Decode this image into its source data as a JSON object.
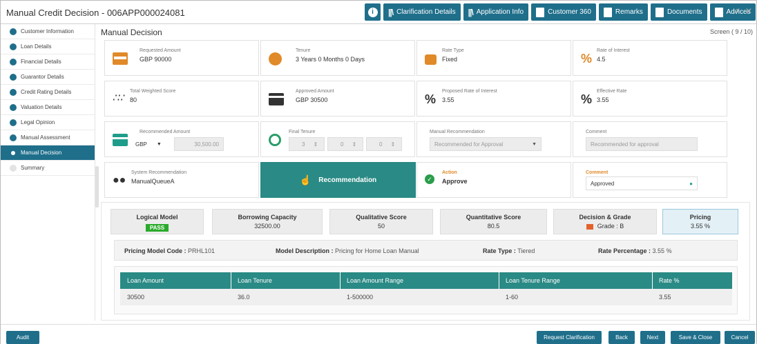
{
  "app": {
    "title": "Manual Credit Decision - 006APP000024081"
  },
  "toolbar": {
    "info_label": "i",
    "clarification": "Clarification Details",
    "application_info": "Application Info",
    "customer360": "Customer 360",
    "remarks": "Remarks",
    "documents": "Documents",
    "advices": "Advices"
  },
  "sidebar": {
    "items": [
      {
        "label": "Customer Information"
      },
      {
        "label": "Loan Details"
      },
      {
        "label": "Financial Details"
      },
      {
        "label": "Guarantor Details"
      },
      {
        "label": "Credit Rating Details"
      },
      {
        "label": "Valuation Details"
      },
      {
        "label": "Legal Opinion"
      },
      {
        "label": "Manual Assessment"
      },
      {
        "label": "Manual Decision"
      },
      {
        "label": "Summary"
      }
    ]
  },
  "main": {
    "title": "Manual Decision",
    "screen": "Screen ( 9 / 10)"
  },
  "cards": {
    "requested": {
      "label": "Requested Amount",
      "value": "GBP 90000"
    },
    "tenure": {
      "label": "Tenure",
      "value": "3 Years 0 Months 0 Days"
    },
    "rate_type": {
      "label": "Rate Type",
      "value": "Fixed"
    },
    "roi": {
      "label": "Rate of Interest",
      "value": "4.5"
    },
    "tws": {
      "label": "Total Weighted Score",
      "value": "80"
    },
    "approved": {
      "label": "Approved Amount",
      "value": "GBP 30500"
    },
    "proposed": {
      "label": "Proposed Rate of Interest",
      "value": "3.55"
    },
    "effective": {
      "label": "Effective Rate",
      "value": "3.55"
    },
    "recommended": {
      "label": "Recommended Amount",
      "currency": "GBP",
      "amount": "30,500.00"
    },
    "final_tenure": {
      "label": "Final Tenure",
      "years": "3",
      "months": "0",
      "days": "0"
    },
    "manual_rec": {
      "label": "Manual Recommendation",
      "value": "Recommended for Approval"
    },
    "comment1": {
      "label": "Comment",
      "value": "Recommended for approval"
    },
    "system_rec": {
      "label": "System Recommendation",
      "value": "ManualQueueA"
    },
    "recommendation_btn": "Recommendation",
    "action": {
      "label": "Action",
      "value": "Approve"
    },
    "comment2": {
      "label": "Comment",
      "value": "Approved"
    }
  },
  "models": {
    "logical": {
      "title": "Logical Model",
      "value": "PASS"
    },
    "borrowing": {
      "title": "Borrowing Capacity",
      "value": "32500.00"
    },
    "qualitative": {
      "title": "Qualitative Score",
      "value": "50"
    },
    "quantitative": {
      "title": "Quantitative Score",
      "value": "80.5"
    },
    "decision": {
      "title": "Decision & Grade",
      "value": "Grade : B"
    },
    "pricing": {
      "title": "Pricing",
      "value": "3.55 %"
    }
  },
  "pricing_info": {
    "code_label": "Pricing Model Code :",
    "code": "PRHL101",
    "desc_label": "Model Description :",
    "desc": "Pricing for Home Loan Manual",
    "type_label": "Rate Type :",
    "type": "Tiered",
    "pct_label": "Rate Percentage :",
    "pct": "3.55 %"
  },
  "table": {
    "headers": [
      "Loan Amount",
      "Loan Tenure",
      "Loan Amount Range",
      "Loan Tenure Range",
      "Rate %"
    ],
    "rows": [
      [
        "30500",
        "36.0",
        "1-500000",
        "1-60",
        "3.55"
      ]
    ]
  },
  "footer": {
    "audit": "Audit",
    "request": "Request Clarification",
    "back": "Back",
    "next": "Next",
    "save": "Save & Close",
    "cancel": "Cancel"
  },
  "colors": {
    "primary": "#1f6f8b",
    "teal": "#2a8a85",
    "accent": "#e08a2a",
    "pass": "#2aaa2a"
  }
}
